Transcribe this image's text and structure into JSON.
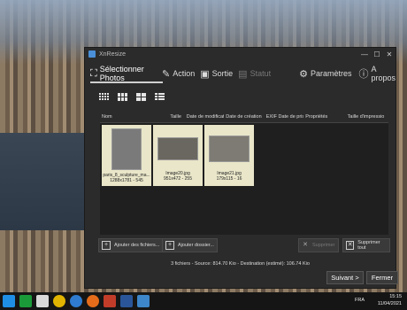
{
  "window": {
    "title": "XnResize",
    "minimize": "—",
    "maximize": "☐",
    "close": "✕"
  },
  "nav": {
    "select_photos": "Sélectionner Photos",
    "action": "Action",
    "output": "Sortie",
    "status": "Statut",
    "settings": "Paramètres",
    "about": "A propos"
  },
  "columns": [
    "Nom",
    "Taille",
    "Date de modificati",
    "Date de création",
    "EXIF Date de prise",
    "Propriétés",
    "Taille d'impressio"
  ],
  "files": [
    {
      "name": "paris_8_sculpture_ma...",
      "meta": "1288x1781 - 545"
    },
    {
      "name": "Image20.jpg",
      "meta": "951x472 - 255"
    },
    {
      "name": "Image21.jpg",
      "meta": "179x115 - 16"
    }
  ],
  "actions": {
    "add_files": "Ajouter des fichiers...",
    "add_folder": "Ajouter dossier...",
    "remove": "Supprimer",
    "remove_all": "Supprimer tout"
  },
  "status_text": "3 fichiers - Source: 814.70 Kio - Destination (estimé): 106.74 Kio",
  "buttons": {
    "next": "Suivant >",
    "close": "Fermer"
  },
  "taskbar": {
    "lang": "FRA",
    "time": "15:15",
    "date": "11/04/2021"
  },
  "colors": {
    "window_bg": "#2b2b2b",
    "selected_thumb": "#e9e6c9"
  }
}
